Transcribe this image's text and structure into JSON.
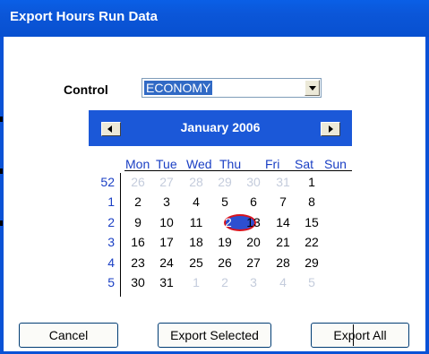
{
  "window": {
    "title": "Export Hours Run Data"
  },
  "control": {
    "label": "Control",
    "selected": "ECONOMY"
  },
  "calendar": {
    "month_label": "January 2006",
    "weekdays": [
      "Mon",
      "Tue",
      "Wed",
      "Thu",
      "Fri",
      "Sat",
      "Sun"
    ],
    "weeks": [
      {
        "num": "52",
        "days": [
          {
            "d": "26",
            "o": true
          },
          {
            "d": "27",
            "o": true
          },
          {
            "d": "28",
            "o": true
          },
          {
            "d": "29",
            "o": true
          },
          {
            "d": "30",
            "o": true
          },
          {
            "d": "31",
            "o": true
          },
          {
            "d": "1",
            "o": false
          }
        ]
      },
      {
        "num": "1",
        "days": [
          {
            "d": "2",
            "o": false
          },
          {
            "d": "3",
            "o": false
          },
          {
            "d": "4",
            "o": false
          },
          {
            "d": "5",
            "o": false
          },
          {
            "d": "6",
            "o": false
          },
          {
            "d": "7",
            "o": false
          },
          {
            "d": "8",
            "o": false
          }
        ]
      },
      {
        "num": "2",
        "days": [
          {
            "d": "9",
            "o": false
          },
          {
            "d": "10",
            "o": false
          },
          {
            "d": "11",
            "o": false
          },
          {
            "d": "12",
            "o": false,
            "sel": true
          },
          {
            "d": "13",
            "o": false
          },
          {
            "d": "14",
            "o": false
          },
          {
            "d": "15",
            "o": false
          }
        ]
      },
      {
        "num": "3",
        "days": [
          {
            "d": "16",
            "o": false
          },
          {
            "d": "17",
            "o": false
          },
          {
            "d": "18",
            "o": false
          },
          {
            "d": "19",
            "o": false
          },
          {
            "d": "20",
            "o": false
          },
          {
            "d": "21",
            "o": false
          },
          {
            "d": "22",
            "o": false
          }
        ]
      },
      {
        "num": "4",
        "days": [
          {
            "d": "23",
            "o": false
          },
          {
            "d": "24",
            "o": false
          },
          {
            "d": "25",
            "o": false
          },
          {
            "d": "26",
            "o": false
          },
          {
            "d": "27",
            "o": false
          },
          {
            "d": "28",
            "o": false
          },
          {
            "d": "29",
            "o": false
          }
        ]
      },
      {
        "num": "5",
        "days": [
          {
            "d": "30",
            "o": false
          },
          {
            "d": "31",
            "o": false
          },
          {
            "d": "1",
            "o": true
          },
          {
            "d": "2",
            "o": true
          },
          {
            "d": "3",
            "o": true
          },
          {
            "d": "4",
            "o": true
          },
          {
            "d": "5",
            "o": true
          }
        ]
      }
    ],
    "prev_icon": "triangle-left-icon",
    "next_icon": "triangle-right-icon"
  },
  "buttons": {
    "cancel": "Cancel",
    "export_selected": "Export Selected",
    "export_all": "Export All"
  },
  "colors": {
    "title_bar": "#0a5fe6",
    "calendar_header": "#1b58d8",
    "week_numbers": "#1a3fc4",
    "selected_day_fill": "#2d4fd0",
    "selected_day_ring": "#d8141f"
  }
}
